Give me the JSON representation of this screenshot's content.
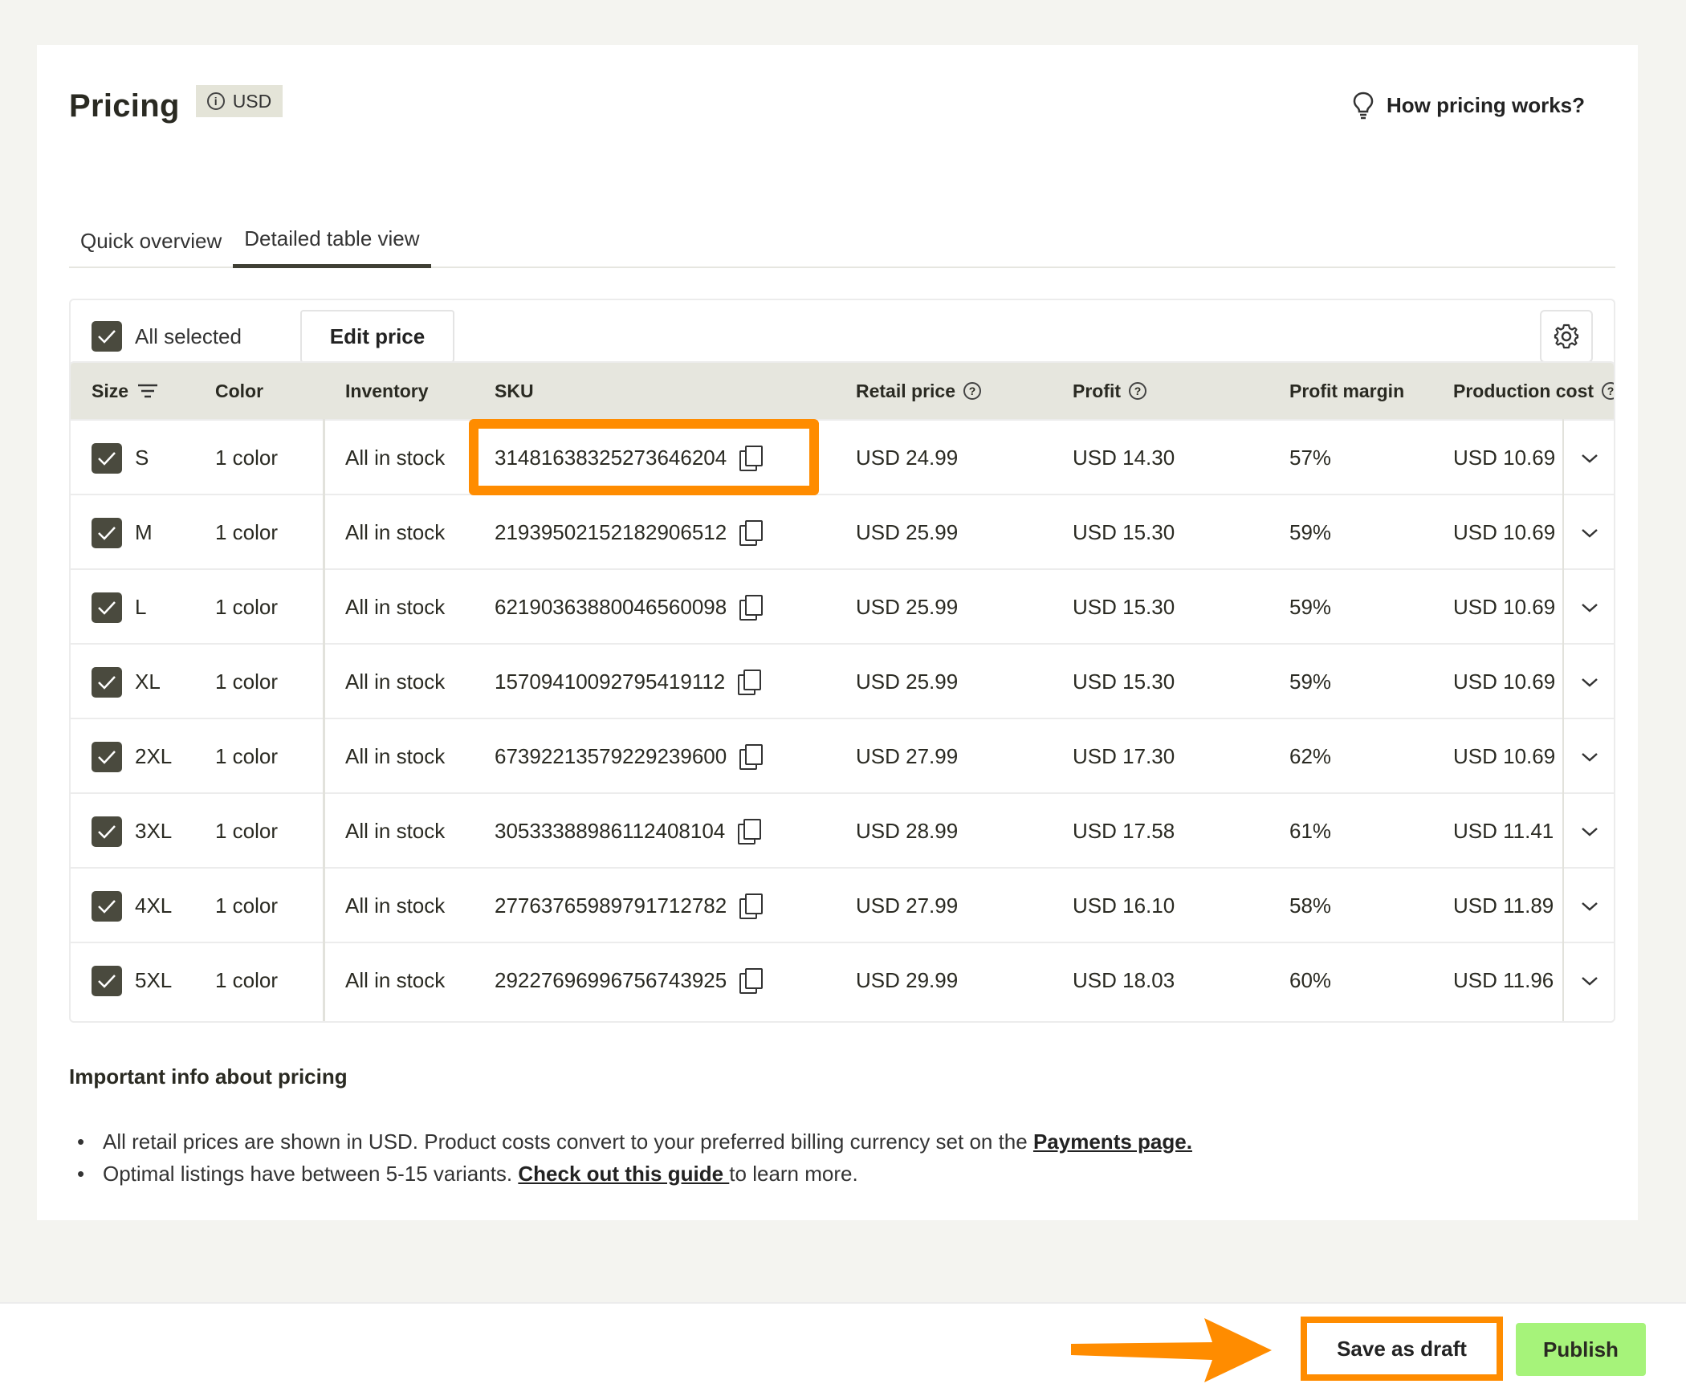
{
  "header": {
    "title": "Pricing",
    "currency_badge": "USD",
    "help_link": "How pricing works?"
  },
  "tabs": [
    {
      "label": "Quick overview",
      "active": false
    },
    {
      "label": "Detailed table view",
      "active": true
    }
  ],
  "toolbar": {
    "select_all_label": "All selected",
    "edit_price_label": "Edit price"
  },
  "table": {
    "columns": [
      "Size",
      "Color",
      "Inventory",
      "SKU",
      "Retail price",
      "Profit",
      "Profit margin",
      "Production cost"
    ],
    "rows": [
      {
        "size": "S",
        "color": "1 color",
        "inventory": "All in stock",
        "sku": "3148163832527364620​4",
        "retail": "USD 24.99",
        "profit": "USD 14.30",
        "margin": "57%",
        "cost": "USD 10.69"
      },
      {
        "size": "M",
        "color": "1 color",
        "inventory": "All in stock",
        "sku": "21939502152182906512",
        "retail": "USD 25.99",
        "profit": "USD 15.30",
        "margin": "59%",
        "cost": "USD 10.69"
      },
      {
        "size": "L",
        "color": "1 color",
        "inventory": "All in stock",
        "sku": "62190363880046560098",
        "retail": "USD 25.99",
        "profit": "USD 15.30",
        "margin": "59%",
        "cost": "USD 10.69"
      },
      {
        "size": "XL",
        "color": "1 color",
        "inventory": "All in stock",
        "sku": "15709410092795419112",
        "retail": "USD 25.99",
        "profit": "USD 15.30",
        "margin": "59%",
        "cost": "USD 10.69"
      },
      {
        "size": "2XL",
        "color": "1 color",
        "inventory": "All in stock",
        "sku": "67392213579229239600",
        "retail": "USD 27.99",
        "profit": "USD 17.30",
        "margin": "62%",
        "cost": "USD 10.69"
      },
      {
        "size": "3XL",
        "color": "1 color",
        "inventory": "All in stock",
        "sku": "30533388986112408104",
        "retail": "USD 28.99",
        "profit": "USD 17.58",
        "margin": "61%",
        "cost": "USD 11.41"
      },
      {
        "size": "4XL",
        "color": "1 color",
        "inventory": "All in stock",
        "sku": "27763765989791712782",
        "retail": "USD 27.99",
        "profit": "USD 16.10",
        "margin": "58%",
        "cost": "USD 11.89"
      },
      {
        "size": "5XL",
        "color": "1 color",
        "inventory": "All in stock",
        "sku": "29227696996756743925",
        "retail": "USD 29.99",
        "profit": "USD 18.03",
        "margin": "60%",
        "cost": "USD 11.96"
      }
    ]
  },
  "info": {
    "title": "Important info about pricing",
    "line1_text": "All retail prices are shown in USD. Product costs convert to your preferred billing currency set on the ",
    "line1_link": "Payments page.",
    "line2_text": "Optimal listings have between 5-15 variants. ",
    "line2_link": "Check out this guide ",
    "line2_tail": "to learn more."
  },
  "footer": {
    "draft_label": "Save as draft",
    "publish_label": "Publish"
  },
  "colors": {
    "highlight": "#ff8c00",
    "publish_bg": "#a6f37a",
    "checkbox": "#4a4a3e",
    "header_bg": "#e6e6de"
  }
}
